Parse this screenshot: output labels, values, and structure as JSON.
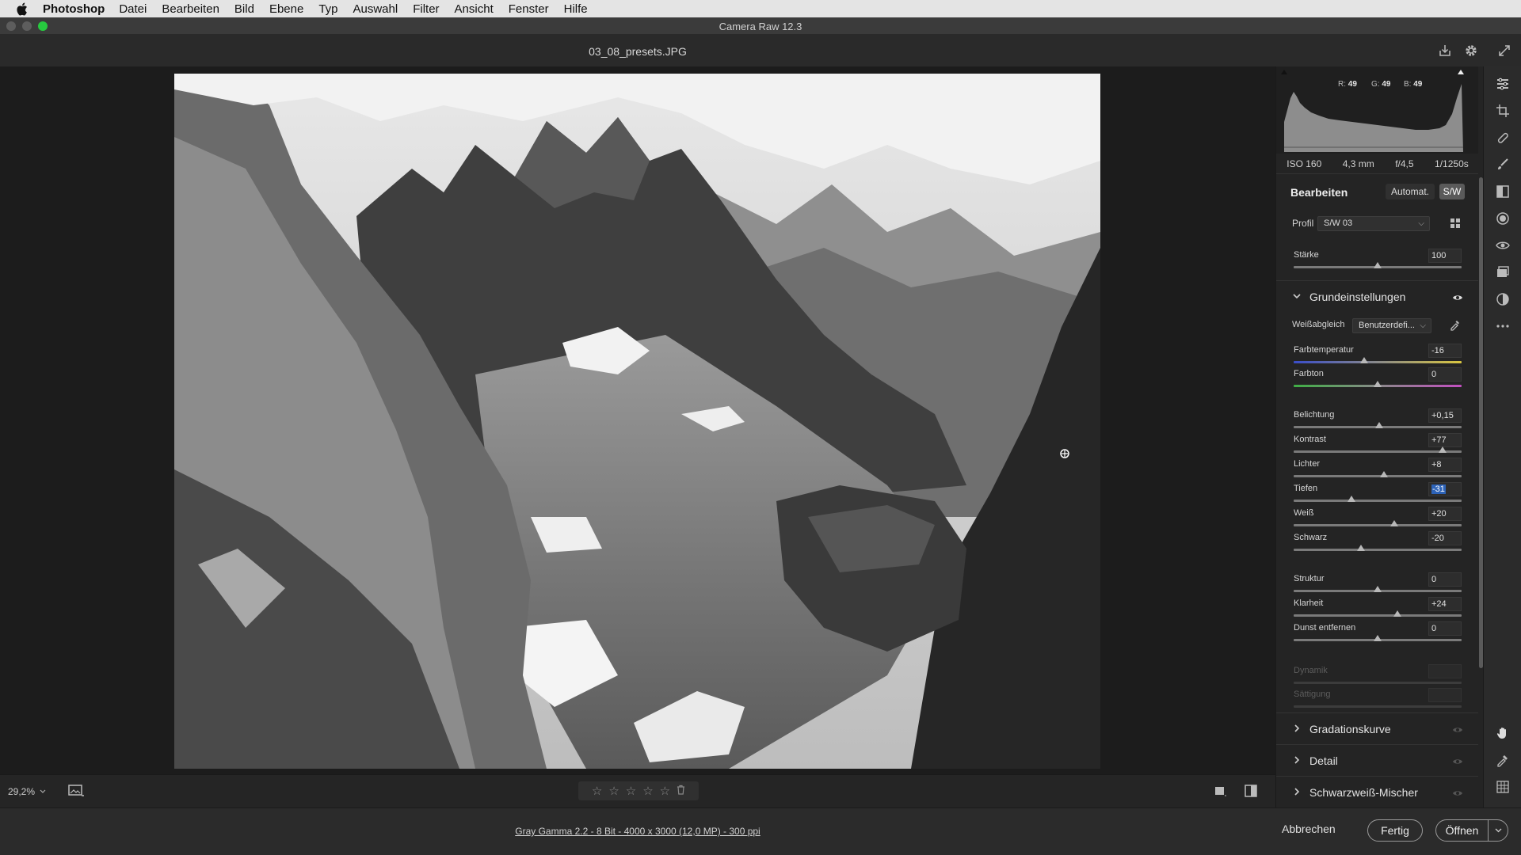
{
  "menubar": {
    "app_name": "Photoshop",
    "items": [
      "Datei",
      "Bearbeiten",
      "Bild",
      "Ebene",
      "Typ",
      "Auswahl",
      "Filter",
      "Ansicht",
      "Fenster",
      "Hilfe"
    ]
  },
  "window": {
    "title": "Camera Raw 12.3"
  },
  "file": {
    "name": "03_08_presets.JPG"
  },
  "histogram": {
    "r_label": "R:",
    "r": "49",
    "g_label": "G:",
    "g": "49",
    "b_label": "B:",
    "b": "49"
  },
  "exif": {
    "iso": "ISO 160",
    "focal": "4,3 mm",
    "aperture": "f/4,5",
    "shutter": "1/1250s"
  },
  "edit": {
    "title": "Bearbeiten",
    "auto_label": "Automat.",
    "bw_label": "S/W",
    "profile_label": "Profil",
    "profile_value": "S/W 03",
    "amount": {
      "label": "Stärke",
      "value": "100",
      "level": 0.5
    }
  },
  "basic": {
    "title": "Grundeinstellungen",
    "wb_label": "Weißabgleich",
    "wb_value": "Benutzerdefi...",
    "sliders": [
      {
        "label": "Farbtemperatur",
        "value": "-16",
        "level": 0.42
      },
      {
        "label": "Farbton",
        "value": "0",
        "level": 0.5
      },
      {
        "label": "Belichtung",
        "value": "+0,15",
        "level": 0.51
      },
      {
        "label": "Kontrast",
        "value": "+77",
        "level": 0.885
      },
      {
        "label": "Lichter",
        "value": "+8",
        "level": 0.54
      },
      {
        "label": "Tiefen",
        "value": "-31",
        "level": 0.345
      },
      {
        "label": "Weiß",
        "value": "+20",
        "level": 0.6
      },
      {
        "label": "Schwarz",
        "value": "-20",
        "level": 0.4
      },
      {
        "label": "Struktur",
        "value": "0",
        "level": 0.5
      },
      {
        "label": "Klarheit",
        "value": "+24",
        "level": 0.62
      },
      {
        "label": "Dunst entfernen",
        "value": "0",
        "level": 0.5
      },
      {
        "label": "Dynamik",
        "value": "",
        "level": 0.5
      },
      {
        "label": "Sättigung",
        "value": "",
        "level": 0.5
      }
    ]
  },
  "sections": [
    {
      "name": "Gradationskurve"
    },
    {
      "name": "Detail"
    },
    {
      "name": "Schwarzweiß-Mischer"
    }
  ],
  "canvas": {
    "zoom": "29,2%"
  },
  "footer": {
    "info": "Gray Gamma 2.2 - 8 Bit - 4000 x 3000 (12,0 MP) - 300 ppi",
    "cancel": "Abbrechen",
    "done": "Fertig",
    "open": "Öffnen"
  },
  "colors": {
    "accent": "#2d63b8",
    "panel_bg": "#242424",
    "canvas_bg": "#1c1c1c"
  }
}
